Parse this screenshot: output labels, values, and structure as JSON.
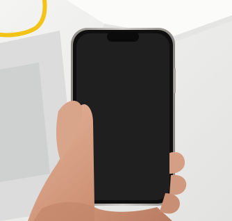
{
  "photo": {
    "subject": "hand-holding-smartphone",
    "colors": {
      "background": "#ededeb",
      "screen": "#1c1c1c",
      "phone_frame": "#b9b6b0",
      "skin": "#d9a58a",
      "scribble": "#f3c316"
    }
  }
}
